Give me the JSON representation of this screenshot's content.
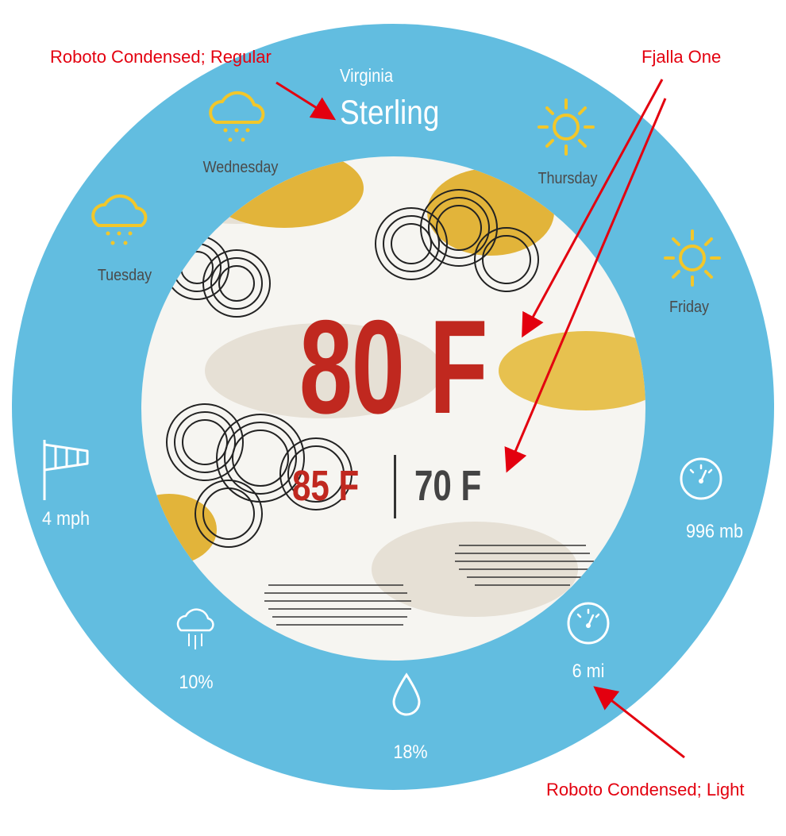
{
  "location": {
    "state": "Virginia",
    "city": "Sterling"
  },
  "current": {
    "temperature": "80 F",
    "high": "85 F",
    "low": "70 F"
  },
  "forecast": [
    {
      "day": "Tuesday",
      "icon": "rain-cloud-icon"
    },
    {
      "day": "Wednesday",
      "icon": "rain-cloud-icon"
    },
    {
      "day": "Thursday",
      "icon": "sun-icon"
    },
    {
      "day": "Friday",
      "icon": "sun-icon"
    }
  ],
  "conditions": {
    "wind": {
      "value": "4 mph",
      "icon": "windsock-icon"
    },
    "precipitation": {
      "value": "10%",
      "icon": "rain-cloud-icon"
    },
    "humidity": {
      "value": "18%",
      "icon": "droplet-icon"
    },
    "visibility": {
      "value": "6 mi",
      "icon": "gauge-icon"
    },
    "pressure": {
      "value": "996 mb",
      "icon": "gauge-icon"
    }
  },
  "annotations": {
    "top_left": "Roboto Condensed; Regular",
    "top_right": "Fjalla One",
    "bottom_right": "Roboto Condensed; Light"
  },
  "colors": {
    "ring": "#62bde0",
    "icon_yellow": "#f2c72a",
    "temp_red": "#c0281f",
    "annotation_red": "#e3000f"
  }
}
